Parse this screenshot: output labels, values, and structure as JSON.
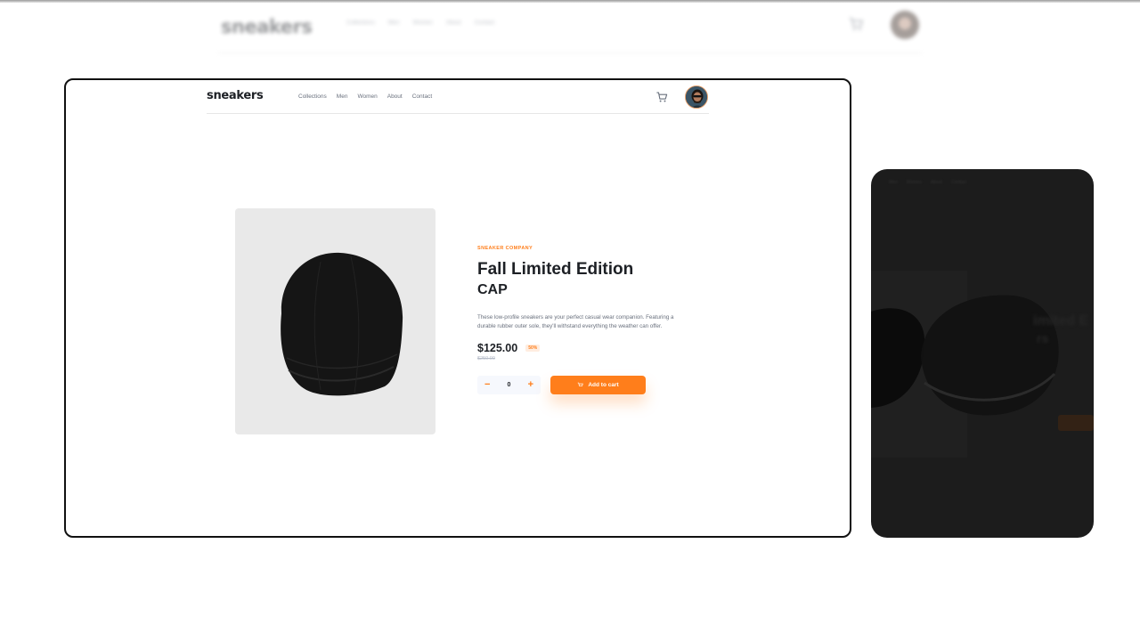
{
  "app": {
    "logo": "sneakers",
    "nav": [
      "Collections",
      "Men",
      "Women",
      "About",
      "Contact"
    ]
  },
  "icons": {
    "cart": "cart-icon",
    "avatar": "user-avatar",
    "minus": "minus-icon",
    "plus": "plus-icon",
    "product": "cap-image"
  },
  "product": {
    "brand": "SNEAKER COMPANY",
    "title_line1": "Fall Limited Edition",
    "title_line2": "CAP",
    "description": "These low-profile sneakers are your perfect casual wear companion. Featuring a durable rubber outer sole, they'll withstand everything the weather can offer.",
    "price": "$125.00",
    "discount": "50%",
    "original_price": "$250.00"
  },
  "cart_controls": {
    "quantity": "0",
    "minus_symbol": "−",
    "plus_symbol": "+",
    "add_label": "Add to cart"
  },
  "colors": {
    "accent": "#ff7e1b",
    "text_dark": "#1d2025",
    "text_muted": "#69707d",
    "photo_bg": "#e9e9e9"
  }
}
